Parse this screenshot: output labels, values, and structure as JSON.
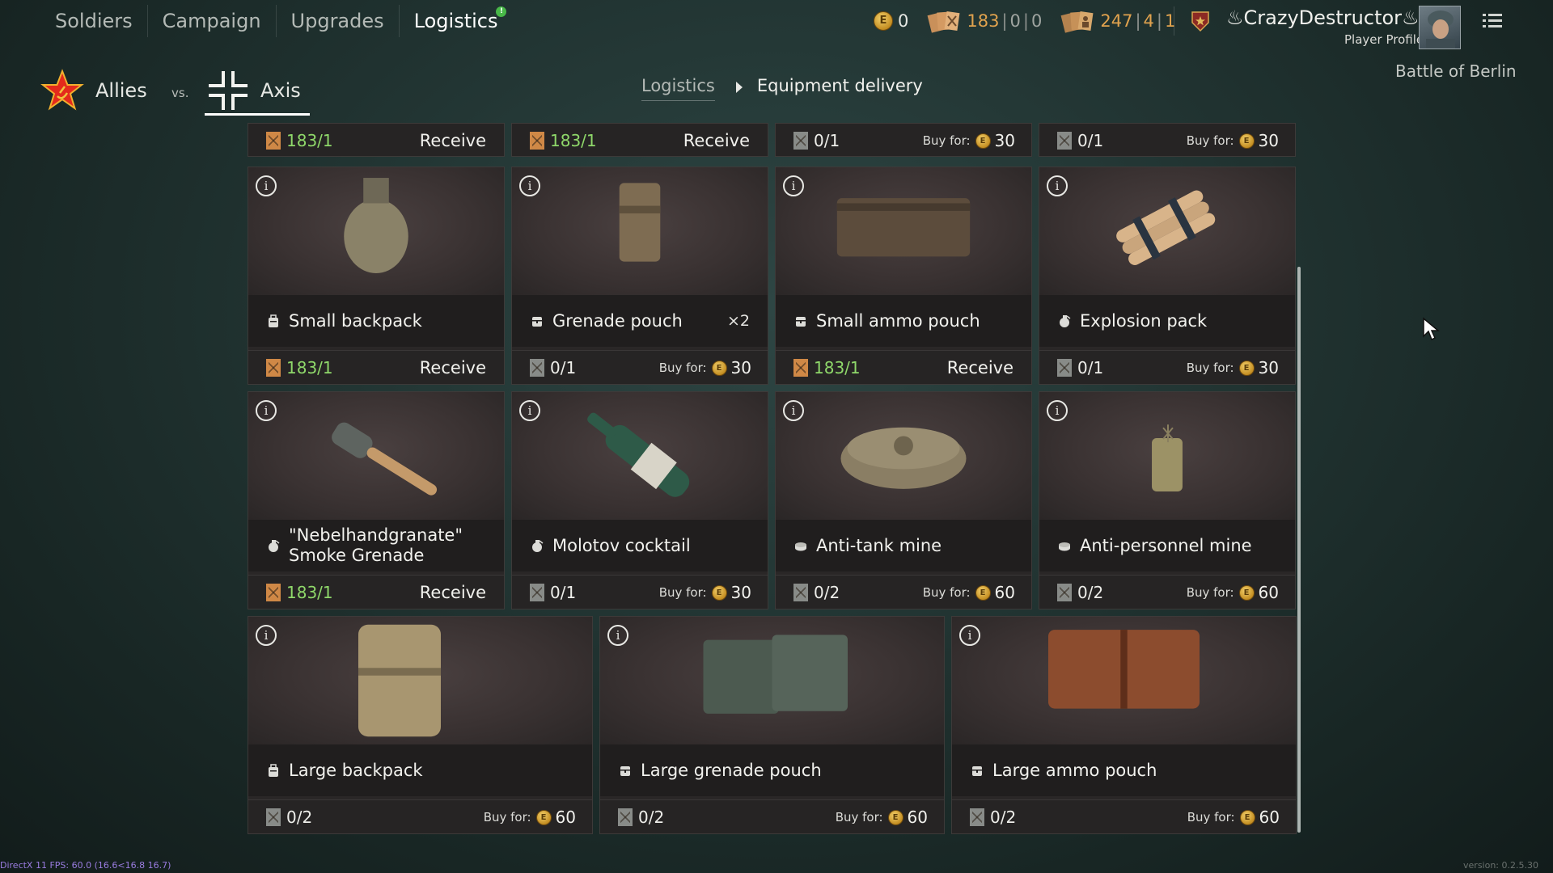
{
  "nav": {
    "tabs": [
      {
        "label": "Soldiers"
      },
      {
        "label": "Campaign"
      },
      {
        "label": "Upgrades"
      },
      {
        "label": "Logistics",
        "notification": "!"
      }
    ]
  },
  "currencies": {
    "gold": "0",
    "orders_a": {
      "values": [
        "183",
        "0",
        "0"
      ]
    },
    "orders_b": {
      "values": [
        "247",
        "4",
        "1"
      ]
    }
  },
  "player": {
    "name": "CrazyDestructor",
    "label": "Player Profile"
  },
  "sides": {
    "allies": "Allies",
    "vs": "vs.",
    "axis": "Axis"
  },
  "breadcrumb": {
    "parent": "Logistics",
    "current": "Equipment delivery"
  },
  "campaign_name": "Battle of Berlin",
  "buy_label": "Buy for:",
  "receive_label": "Receive",
  "coin_letter": "E",
  "info_symbol": "i",
  "top_strip": [
    {
      "count": "183/1",
      "available": true,
      "action": "receive"
    },
    {
      "count": "183/1",
      "available": true,
      "action": "receive"
    },
    {
      "count": "0/1",
      "available": false,
      "action": "buy",
      "price": "30"
    },
    {
      "count": "0/1",
      "available": false,
      "action": "buy",
      "price": "30"
    }
  ],
  "items": [
    {
      "name": "Small backpack",
      "icon": "backpack-icon",
      "count": "183/1",
      "available": true,
      "action": "receive"
    },
    {
      "name": "Grenade pouch",
      "icon": "pouch-icon",
      "multiplier": "×2",
      "count": "0/1",
      "available": false,
      "action": "buy",
      "price": "30"
    },
    {
      "name": "Small ammo pouch",
      "icon": "pouch-icon",
      "count": "183/1",
      "available": true,
      "action": "receive"
    },
    {
      "name": "Explosion pack",
      "icon": "grenade-icon",
      "count": "0/1",
      "available": false,
      "action": "buy",
      "price": "30"
    },
    {
      "name": "\"Nebelhandgranate\" Smoke Grenade",
      "icon": "grenade-icon",
      "count": "183/1",
      "available": true,
      "action": "receive"
    },
    {
      "name": "Molotov cocktail",
      "icon": "grenade-icon",
      "count": "0/1",
      "available": false,
      "action": "buy",
      "price": "30"
    },
    {
      "name": "Anti-tank mine",
      "icon": "mine-icon",
      "count": "0/2",
      "available": false,
      "action": "buy",
      "price": "60"
    },
    {
      "name": "Anti-personnel mine",
      "icon": "mine-icon",
      "count": "0/2",
      "available": false,
      "action": "buy",
      "price": "60"
    },
    {
      "name": "Large backpack",
      "icon": "backpack-icon",
      "count": "0/2",
      "available": false,
      "action": "buy",
      "price": "60"
    },
    {
      "name": "Large grenade pouch",
      "icon": "pouch-icon",
      "count": "0/2",
      "available": false,
      "action": "buy",
      "price": "60"
    },
    {
      "name": "Large ammo pouch",
      "icon": "pouch-icon",
      "count": "0/2",
      "available": false,
      "action": "buy",
      "price": "60"
    }
  ],
  "debug": {
    "fps": "DirectX 11 FPS: 60.0 (16.6<16.8 16.7)",
    "version": "version: 0.2.5.30"
  }
}
